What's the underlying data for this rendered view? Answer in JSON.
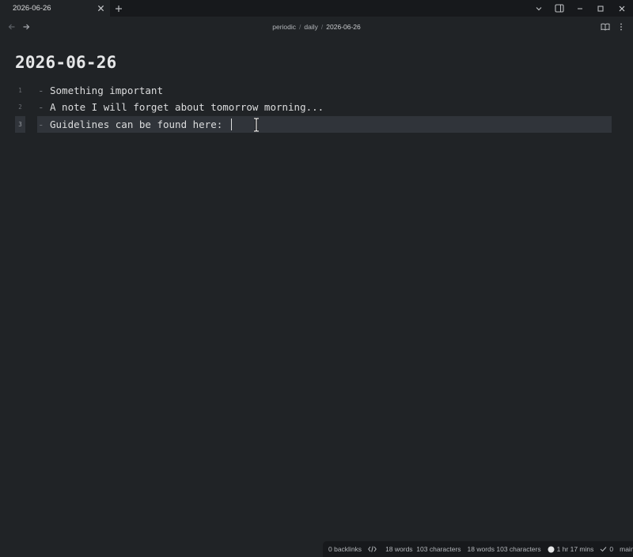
{
  "tabs": [
    {
      "label": "2026-06-26"
    }
  ],
  "breadcrumb": {
    "items": [
      "periodic",
      "daily",
      "2026-06-26"
    ],
    "separator": "/"
  },
  "note": {
    "title": "2026-06-26",
    "lines": [
      {
        "number": "1",
        "marker": "-",
        "text": "Something important"
      },
      {
        "number": "2",
        "marker": "-",
        "text": "A note I will forget about tomorrow morning..."
      },
      {
        "number": "3",
        "marker": "-",
        "text": "Guidelines can be found here: "
      }
    ],
    "active_line": 3
  },
  "status": {
    "backlinks": "0 backlinks",
    "word_count": "18 words",
    "char_count": "103 characters",
    "word_char_count": "18 words 103 characters",
    "time": "1 hr 17 mins",
    "sync_count": "0",
    "branch": "main"
  },
  "icons": {
    "new_tab": "plus-icon",
    "tab_close": "close-icon",
    "back": "arrow-left-icon",
    "forward": "arrow-right-icon",
    "reading_mode": "book-open-icon",
    "more": "more-vertical-icon"
  },
  "colors": {
    "background": "#202326",
    "tabbar": "#17191c",
    "active_line": "#30343a",
    "text": "#dcddde",
    "muted": "#6b6f75"
  }
}
